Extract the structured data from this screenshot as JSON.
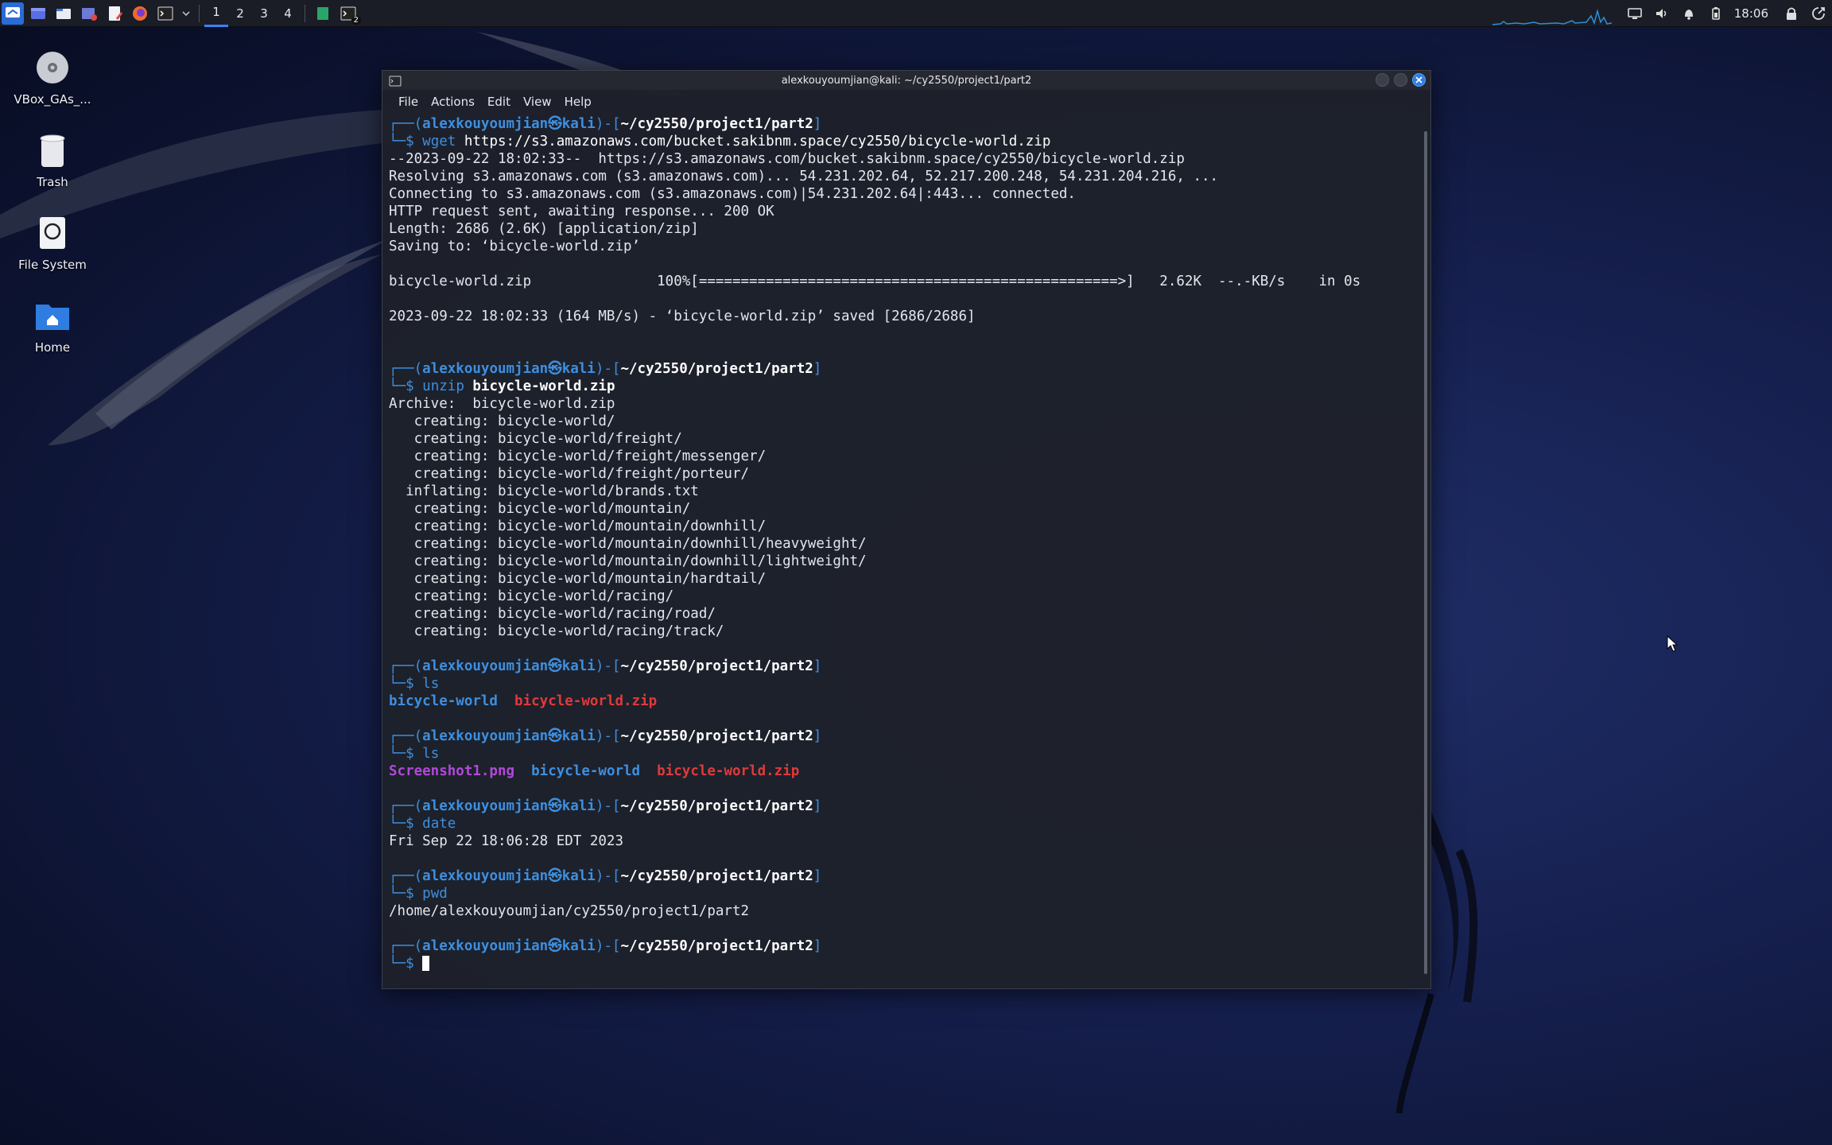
{
  "panel": {
    "workspaces": [
      "1",
      "2",
      "3",
      "4"
    ],
    "clock": "18:06",
    "terminal_badge": "2"
  },
  "desktop": {
    "icons": [
      {
        "label": "VBox_GAs_...",
        "icon": "disc-icon"
      },
      {
        "label": "Trash",
        "icon": "trash-icon"
      },
      {
        "label": "File System",
        "icon": "drive-icon"
      },
      {
        "label": "Home",
        "icon": "home-folder-icon"
      }
    ]
  },
  "window": {
    "title": "alexkouyoumjian@kali: ~/cy2550/project1/part2",
    "menu": [
      "File",
      "Actions",
      "Edit",
      "View",
      "Help"
    ]
  },
  "prompt": {
    "user": "alexkouyoumjian",
    "at": "㉿",
    "host": "kali",
    "path": "~/cy2550/project1/part2",
    "top_open": "┌──(",
    "mid": ")-[",
    "top_close": "]",
    "bottom": "└─",
    "dollar": "$"
  },
  "terminal": {
    "cmd1": {
      "cmd": "wget",
      "args": " https://s3.amazonaws.com/bucket.sakibnm.space/cy2550/bicycle-world.zip"
    },
    "wget_output": [
      "--2023-09-22 18:02:33--  https://s3.amazonaws.com/bucket.sakibnm.space/cy2550/bicycle-world.zip",
      "Resolving s3.amazonaws.com (s3.amazonaws.com)... 54.231.202.64, 52.217.200.248, 54.231.204.216, ...",
      "Connecting to s3.amazonaws.com (s3.amazonaws.com)|54.231.202.64|:443... connected.",
      "HTTP request sent, awaiting response... 200 OK",
      "Length: 2686 (2.6K) [application/zip]",
      "Saving to: ‘bicycle-world.zip’",
      "",
      "bicycle-world.zip               100%[==================================================>]   2.62K  --.-KB/s    in 0s",
      "",
      "2023-09-22 18:02:33 (164 MB/s) - ‘bicycle-world.zip’ saved [2686/2686]",
      "",
      ""
    ],
    "cmd2": {
      "cmd": "unzip",
      "args": " bicycle-world.zip"
    },
    "unzip_output": [
      "Archive:  bicycle-world.zip",
      "   creating: bicycle-world/",
      "   creating: bicycle-world/freight/",
      "   creating: bicycle-world/freight/messenger/",
      "   creating: bicycle-world/freight/porteur/",
      "  inflating: bicycle-world/brands.txt",
      "   creating: bicycle-world/mountain/",
      "   creating: bicycle-world/mountain/downhill/",
      "   creating: bicycle-world/mountain/downhill/heavyweight/",
      "   creating: bicycle-world/mountain/downhill/lightweight/",
      "   creating: bicycle-world/mountain/hardtail/",
      "   creating: bicycle-world/racing/",
      "   creating: bicycle-world/racing/road/",
      "   creating: bicycle-world/racing/track/",
      ""
    ],
    "cmd3": {
      "cmd": "ls"
    },
    "ls1": {
      "dir": "bicycle-world",
      "zip": "bicycle-world.zip"
    },
    "cmd4": {
      "cmd": "ls"
    },
    "ls2": {
      "png": "Screenshot1.png",
      "dir": "bicycle-world",
      "zip": "bicycle-world.zip"
    },
    "cmd5": {
      "cmd": "date"
    },
    "date_output": "Fri Sep 22 18:06:28 EDT 2023",
    "cmd6": {
      "cmd": "pwd"
    },
    "pwd_output": "/home/alexkouyoumjian/cy2550/project1/part2"
  }
}
